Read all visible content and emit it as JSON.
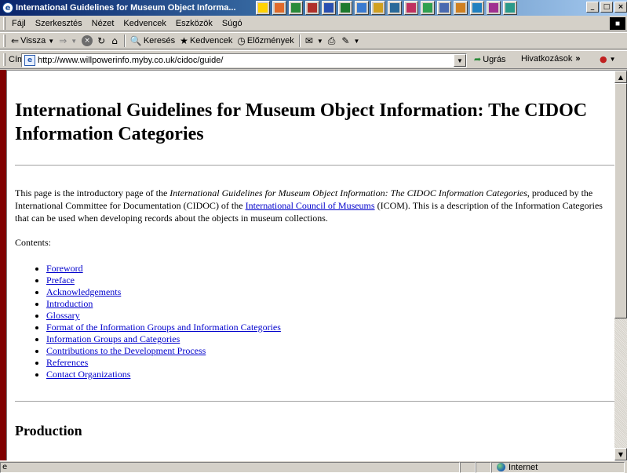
{
  "window": {
    "title": "International Guidelines for Museum Object Informa...",
    "buttons": [
      "_",
      "□",
      "×"
    ]
  },
  "menu": {
    "items": [
      "Fájl",
      "Szerkesztés",
      "Nézet",
      "Kedvencek",
      "Eszközök",
      "Súgó"
    ]
  },
  "toolbar": {
    "back": "Vissza",
    "search": "Keresés",
    "favorites": "Kedvencek",
    "history": "Előzmények"
  },
  "address": {
    "label": "Cím",
    "url": "http://www.willpowerinfo.myby.co.uk/cidoc/guide/",
    "go": "Ugrás",
    "links": "Hivatkozások"
  },
  "page": {
    "title": "International Guidelines for Museum Object Information: The CIDOC Information Categories",
    "intro": {
      "p1": "This page is the introductory page of the ",
      "em": "International Guidelines for Museum Object Information: The CIDOC Information Categories",
      "p2": ", produced by the International Committee for Documentation (CIDOC) of the ",
      "link": "International Council of Museums",
      "p3": " (ICOM). This is a description of the Information Categories that can be used when developing records about the objects in museum collections."
    },
    "contents_label": "Contents:",
    "toc": [
      "Foreword",
      "Preface",
      "Acknowledgements",
      "Introduction",
      "Glossary",
      "Format of the Information Groups and Information Categories",
      "Information Groups and Categories",
      "Contributions to the Development Process",
      "References",
      "Contact Organizations"
    ],
    "section_heading": "Production"
  },
  "status": {
    "zone": "Internet"
  },
  "colors": {
    "link": "#0000cc",
    "titlebar": "#0a246a",
    "chrome": "#d4d0c8"
  }
}
